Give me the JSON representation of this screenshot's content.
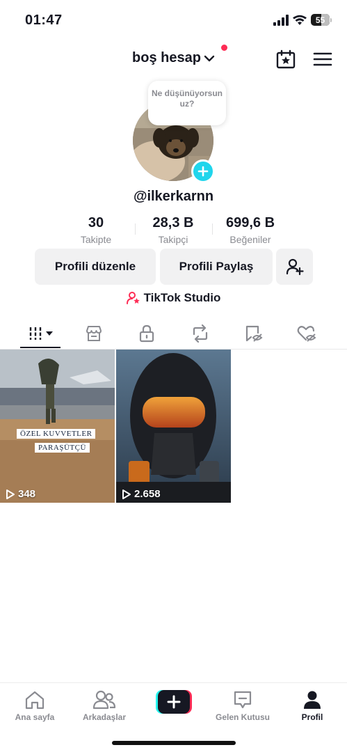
{
  "status_bar": {
    "time": "01:47",
    "battery": "55"
  },
  "header": {
    "account_name": "boş hesap",
    "icons": [
      "calendar-star-icon",
      "hamburger-menu-icon"
    ]
  },
  "profile": {
    "thought_bubble": "Ne düşünüyorsun uz?",
    "username": "@ilkerkarnn"
  },
  "stats": [
    {
      "value": "30",
      "label": "Takipte"
    },
    {
      "value": "28,3 B",
      "label": "Takipçi"
    },
    {
      "value": "699,6 B",
      "label": "Beğeniler"
    }
  ],
  "buttons": {
    "edit_profile": "Profili düzenle",
    "share_profile": "Profili Paylaş"
  },
  "studio_link": "TikTok Studio",
  "tabs": [
    "videos-grid-icon",
    "shop-icon",
    "lock-icon",
    "repost-icon",
    "hidden-favorites-icon",
    "liked-hidden-icon"
  ],
  "videos": [
    {
      "views": "348",
      "caption_line1": "ÖZEL KUVVETLER",
      "caption_line2": "PARAŞÜTÇÜ"
    },
    {
      "views": "2.658"
    }
  ],
  "bottom_nav": [
    {
      "label": "Ana sayfa"
    },
    {
      "label": "Arkadaşlar"
    },
    {
      "label": "+"
    },
    {
      "label": "Gelen Kutusu"
    },
    {
      "label": "Profil"
    }
  ],
  "colors": {
    "accent": "#fe2c55",
    "cyan": "#20d5ec",
    "button_bg": "#f1f1f2",
    "muted_text": "#8a8b91"
  }
}
